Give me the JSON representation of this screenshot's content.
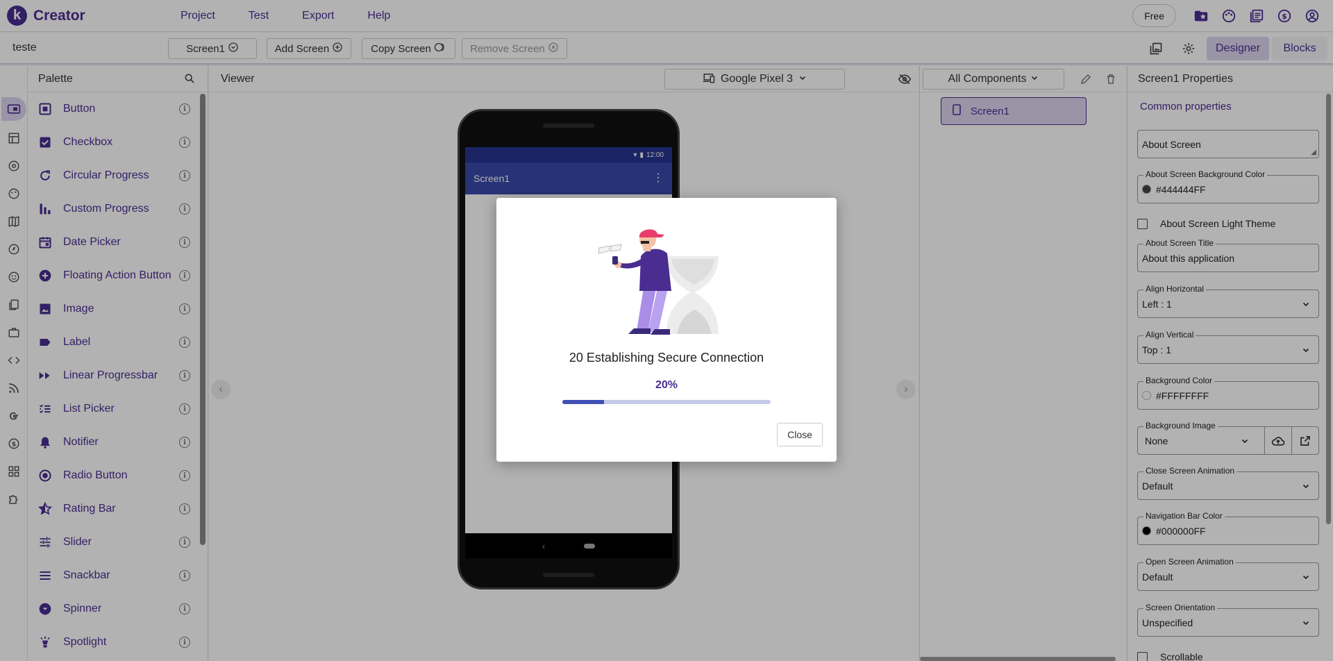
{
  "app": {
    "name": "Creator",
    "logo_letter": "k"
  },
  "menu": [
    "Project",
    "Test",
    "Export",
    "Help"
  ],
  "top_right": {
    "plan": "Free",
    "icons": [
      "folder-star-icon",
      "palette-icon",
      "library-icon",
      "dollar-icon",
      "account-icon"
    ]
  },
  "toolbar": {
    "project_name": "teste",
    "screen_select": "Screen1",
    "add_screen": "Add Screen",
    "copy_screen": "Copy Screen",
    "remove_screen": "Remove Screen",
    "designer": "Designer",
    "blocks": "Blocks"
  },
  "palette": {
    "title": "Palette",
    "items": [
      {
        "label": "Button",
        "icon": "button-icon"
      },
      {
        "label": "Checkbox",
        "icon": "checkbox-icon"
      },
      {
        "label": "Circular Progress",
        "icon": "circular-progress-icon"
      },
      {
        "label": "Custom Progress",
        "icon": "custom-progress-icon"
      },
      {
        "label": "Date Picker",
        "icon": "date-picker-icon"
      },
      {
        "label": "Floating Action Button",
        "icon": "fab-icon"
      },
      {
        "label": "Image",
        "icon": "image-icon"
      },
      {
        "label": "Label",
        "icon": "label-icon"
      },
      {
        "label": "Linear Progressbar",
        "icon": "linear-progress-icon"
      },
      {
        "label": "List Picker",
        "icon": "list-picker-icon"
      },
      {
        "label": "Notifier",
        "icon": "notifier-icon"
      },
      {
        "label": "Radio Button",
        "icon": "radio-button-icon"
      },
      {
        "label": "Rating Bar",
        "icon": "rating-bar-icon"
      },
      {
        "label": "Slider",
        "icon": "slider-icon"
      },
      {
        "label": "Snackbar",
        "icon": "snackbar-icon"
      },
      {
        "label": "Spinner",
        "icon": "spinner-icon"
      },
      {
        "label": "Spotlight",
        "icon": "spotlight-icon"
      }
    ]
  },
  "viewer": {
    "title": "Viewer",
    "device": "Google Pixel 3",
    "phone": {
      "time": "12:00",
      "screen_title": "Screen1"
    }
  },
  "components": {
    "filter": "All Components",
    "root": "Screen1"
  },
  "properties": {
    "title": "Screen1 Properties",
    "tab": "Common properties",
    "about_screen": "About Screen",
    "bg_color_label": "About Screen Background Color",
    "bg_color_value": "#444444FF",
    "bg_color_swatch": "#444444",
    "light_theme": "About Screen Light Theme",
    "title_label": "About Screen Title",
    "title_value": "About this application",
    "align_h_label": "Align Horizontal",
    "align_h_value": "Left : 1",
    "align_v_label": "Align Vertical",
    "align_v_value": "Top : 1",
    "background_color_label": "Background Color",
    "background_color_value": "#FFFFFFFF",
    "background_image_label": "Background Image",
    "background_image_value": "None",
    "close_anim_label": "Close Screen Animation",
    "close_anim_value": "Default",
    "nav_color_label": "Navigation Bar Color",
    "nav_color_value": "#000000FF",
    "open_anim_label": "Open Screen Animation",
    "open_anim_value": "Default",
    "orientation_label": "Screen Orientation",
    "orientation_value": "Unspecified",
    "scrollable": "Scrollable"
  },
  "dialog": {
    "message": "20 Establishing Secure Connection",
    "percent_label": "20%",
    "progress": 0.2,
    "close": "Close"
  },
  "colors": {
    "accent": "#4a2d91",
    "accent_light": "#ddd5f0",
    "progress": "#3f51b5"
  }
}
